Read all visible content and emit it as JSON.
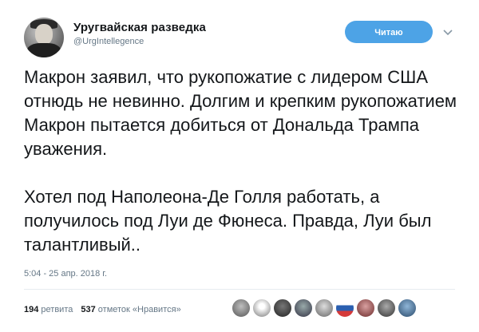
{
  "header": {
    "display_name": "Уругвайская разведка",
    "handle": "@UrgIntellegence",
    "follow_label": "Читаю"
  },
  "tweet": {
    "paragraph1": "Макрон заявил, что рукопожатие с лидером США отнюдь не невинно. Долгим и крепким рукопожатием Макрон пытается добиться от Дональда Трампа уважения.",
    "paragraph2": "Хотел под Наполеона-Де Голля работать, а получилось под Луи де Фюнеса. Правда, Луи был талантливый..",
    "timestamp": "5:04 - 25 апр. 2018 г."
  },
  "stats": {
    "retweets_count": "194",
    "retweets_label": "ретвита",
    "likes_count": "537",
    "likes_label": "отметок «Нравится»"
  },
  "colors": {
    "follow_button": "#4da3e6",
    "secondary_text": "#657786"
  },
  "likers": [
    "avatar-1",
    "avatar-2",
    "avatar-3",
    "avatar-4",
    "avatar-5",
    "avatar-6",
    "avatar-7",
    "avatar-8",
    "avatar-9"
  ]
}
